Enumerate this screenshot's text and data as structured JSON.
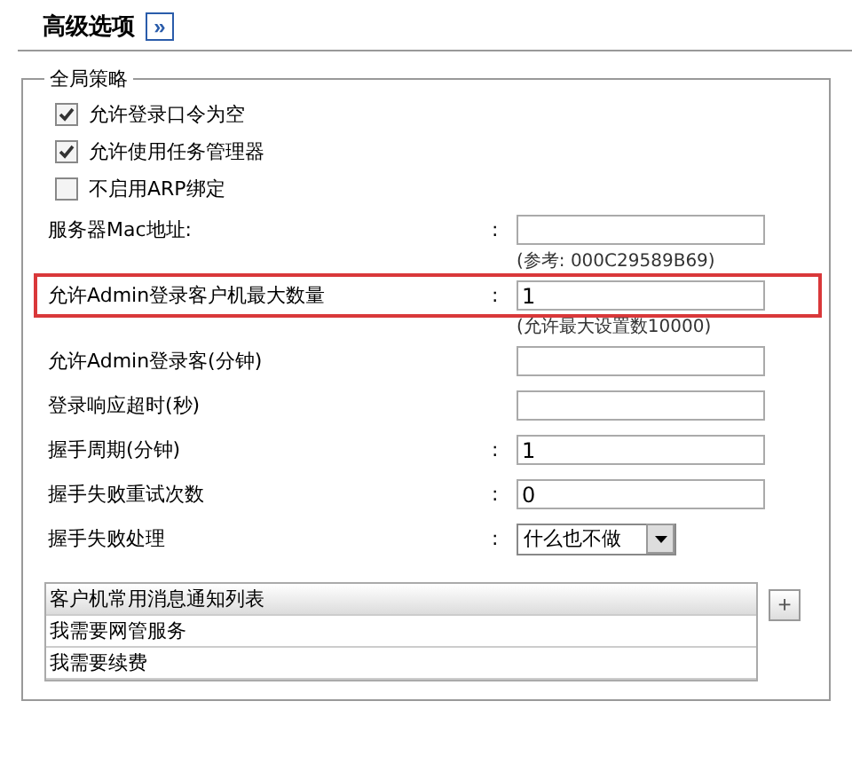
{
  "header": {
    "title": "高级选项",
    "toggle": "»"
  },
  "group": {
    "legend": "全局策略",
    "checkboxes": [
      {
        "label": "允许登录口令为空",
        "checked": true
      },
      {
        "label": "允许使用任务管理器",
        "checked": true
      },
      {
        "label": "不启用ARP绑定",
        "checked": false
      }
    ],
    "fields": [
      {
        "kind": "input",
        "label": "服务器Mac地址:",
        "colon": ":",
        "hint": "(参考: 000C29589B69)",
        "highlighted": false
      },
      {
        "kind": "input",
        "label": "允许Admin登录客户机最大数量",
        "colon": ":",
        "value": "1",
        "hint": "(允许最大设置数10000)",
        "highlighted": true
      },
      {
        "kind": "input",
        "label": "允许Admin登录客(分钟)",
        "highlighted": false
      },
      {
        "kind": "input",
        "label": "登录响应超时(秒)",
        "highlighted": false
      },
      {
        "kind": "input",
        "label": "握手周期(分钟)",
        "colon": ":",
        "value": "1",
        "highlighted": false
      },
      {
        "kind": "input",
        "label": "握手失败重试次数",
        "colon": ":",
        "value": "0",
        "highlighted": false
      },
      {
        "kind": "select",
        "label": "握手失败处理",
        "colon": ":",
        "value": "什么也不做",
        "highlighted": false
      }
    ],
    "list": {
      "items": [
        {
          "text": "客户机常用消息通知列表",
          "selected": true
        },
        {
          "text": "我需要网管服务",
          "selected": false
        },
        {
          "text": "我需要续费",
          "selected": false
        }
      ],
      "buttons": [
        "+"
      ]
    }
  }
}
